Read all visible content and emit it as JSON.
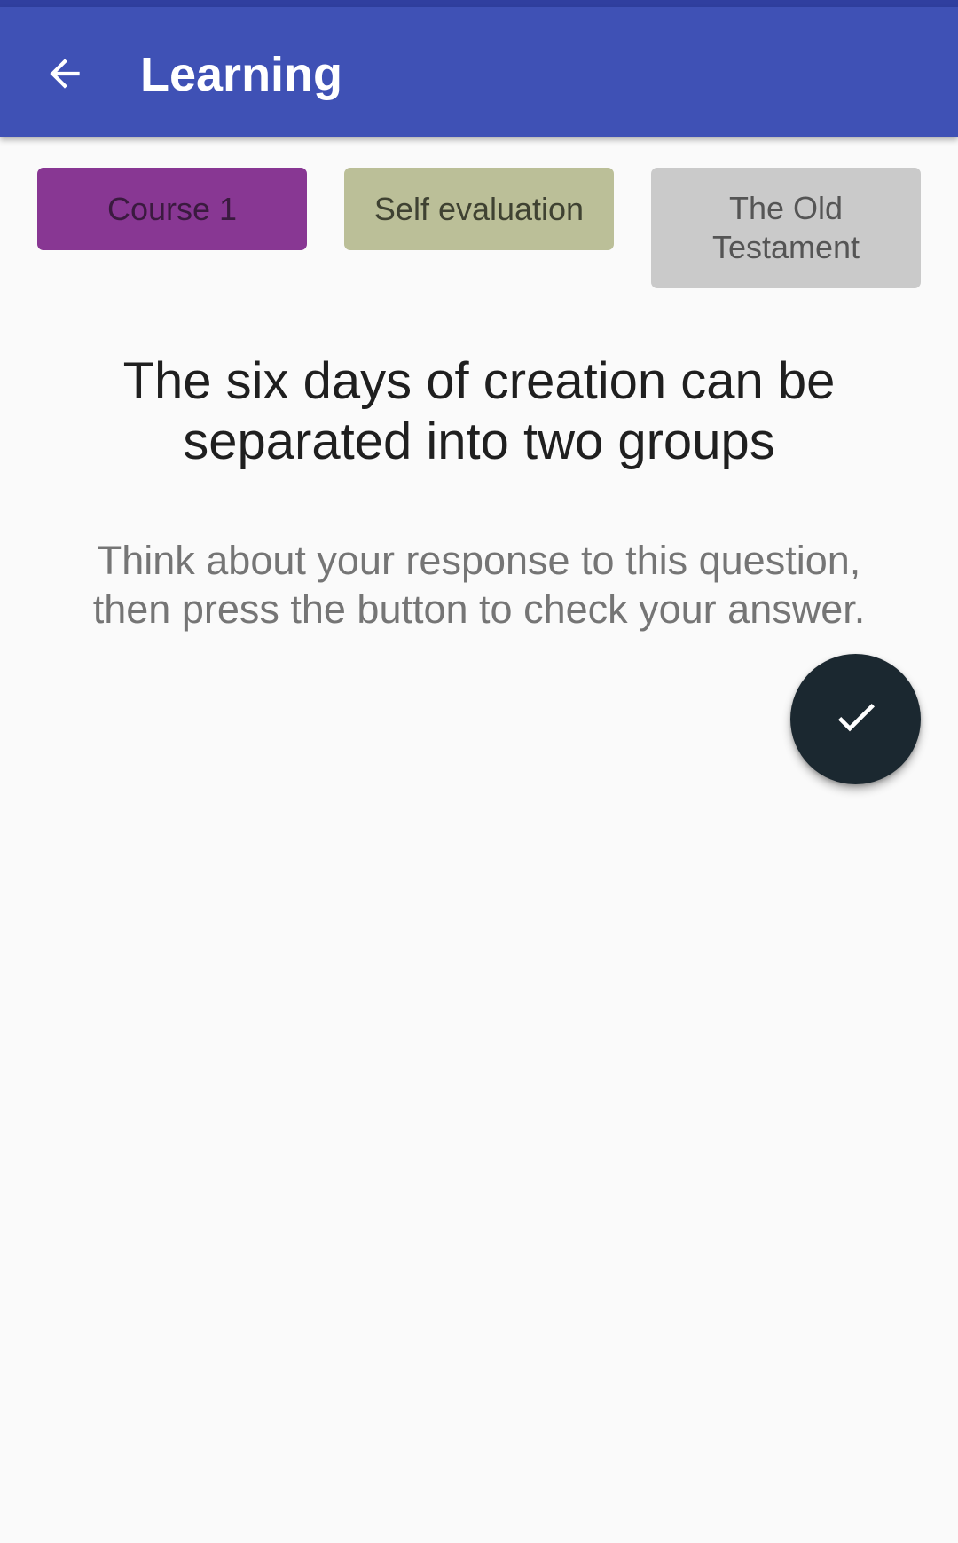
{
  "app_bar": {
    "title": "Learning",
    "back_icon": "arrow-left-icon",
    "background": "#3f51b5",
    "status_bar_color": "#303f9f"
  },
  "chips": [
    {
      "label": "Course 1",
      "color": "#883793"
    },
    {
      "label": "Self evaluation",
      "color": "#bbbf98"
    },
    {
      "label": "The Old Testament",
      "color": "#cacaca"
    }
  ],
  "question": {
    "text": "The six days of creation can be separated into two groups"
  },
  "instruction": {
    "text": "Think about your response to this question, then press the button to check your answer."
  },
  "fab": {
    "icon": "check-icon",
    "background": "#1b2830"
  }
}
